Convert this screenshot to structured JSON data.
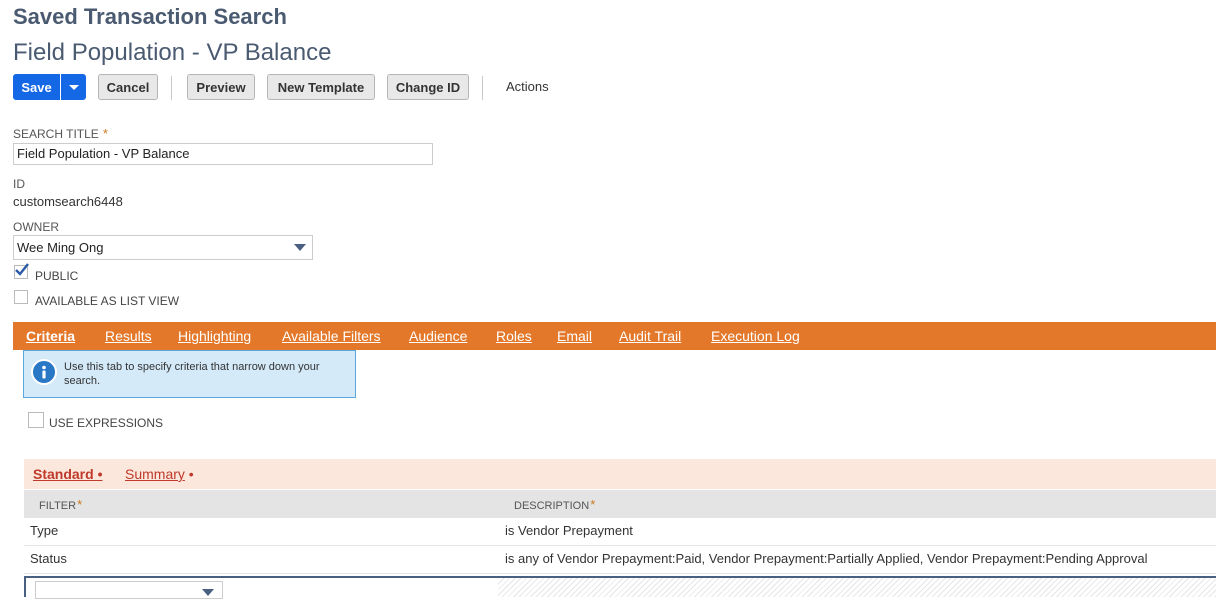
{
  "header": {
    "title": "Saved Transaction Search",
    "subtitle": "Field Population - VP Balance"
  },
  "toolbar": {
    "save_label": "Save",
    "cancel_label": "Cancel",
    "preview_label": "Preview",
    "new_template_label": "New Template",
    "change_id_label": "Change ID",
    "actions_label": "Actions"
  },
  "form": {
    "search_title_label": "SEARCH TITLE",
    "search_title_value": "Field Population - VP Balance",
    "required_mark": "*",
    "id_label": "ID",
    "id_value": "customsearch6448",
    "owner_label": "OWNER",
    "owner_value": "Wee Ming Ong",
    "public_label": "PUBLIC",
    "public_checked": true,
    "list_view_label": "AVAILABLE AS LIST VIEW",
    "list_view_checked": false
  },
  "tabs": [
    {
      "label": "Criteria",
      "active": true
    },
    {
      "label": "Results"
    },
    {
      "label": "Highlighting"
    },
    {
      "label": "Available Filters"
    },
    {
      "label": "Audience"
    },
    {
      "label": "Roles"
    },
    {
      "label": "Email"
    },
    {
      "label": "Audit Trail"
    },
    {
      "label": "Execution Log"
    }
  ],
  "info_box": {
    "icon": "info-icon",
    "text": "Use this tab to specify criteria that narrow down your search."
  },
  "use_expressions_label": "USE EXPRESSIONS",
  "subtabs": [
    {
      "label": "Standard",
      "bullet": "•",
      "active": true
    },
    {
      "label": "Summary",
      "bullet": "•"
    }
  ],
  "grid": {
    "columns": [
      "FILTER",
      "DESCRIPTION"
    ],
    "rows": [
      {
        "filter": "Type",
        "description": "is Vendor Prepayment"
      },
      {
        "filter": "Status",
        "description": "is any of Vendor Prepayment:Paid, Vendor Prepayment:Partially Applied, Vendor Prepayment:Pending Approval"
      }
    ]
  },
  "colors": {
    "accent_orange": "#e3782a",
    "primary_blue": "#1467e5",
    "heading": "#4a5a70"
  }
}
